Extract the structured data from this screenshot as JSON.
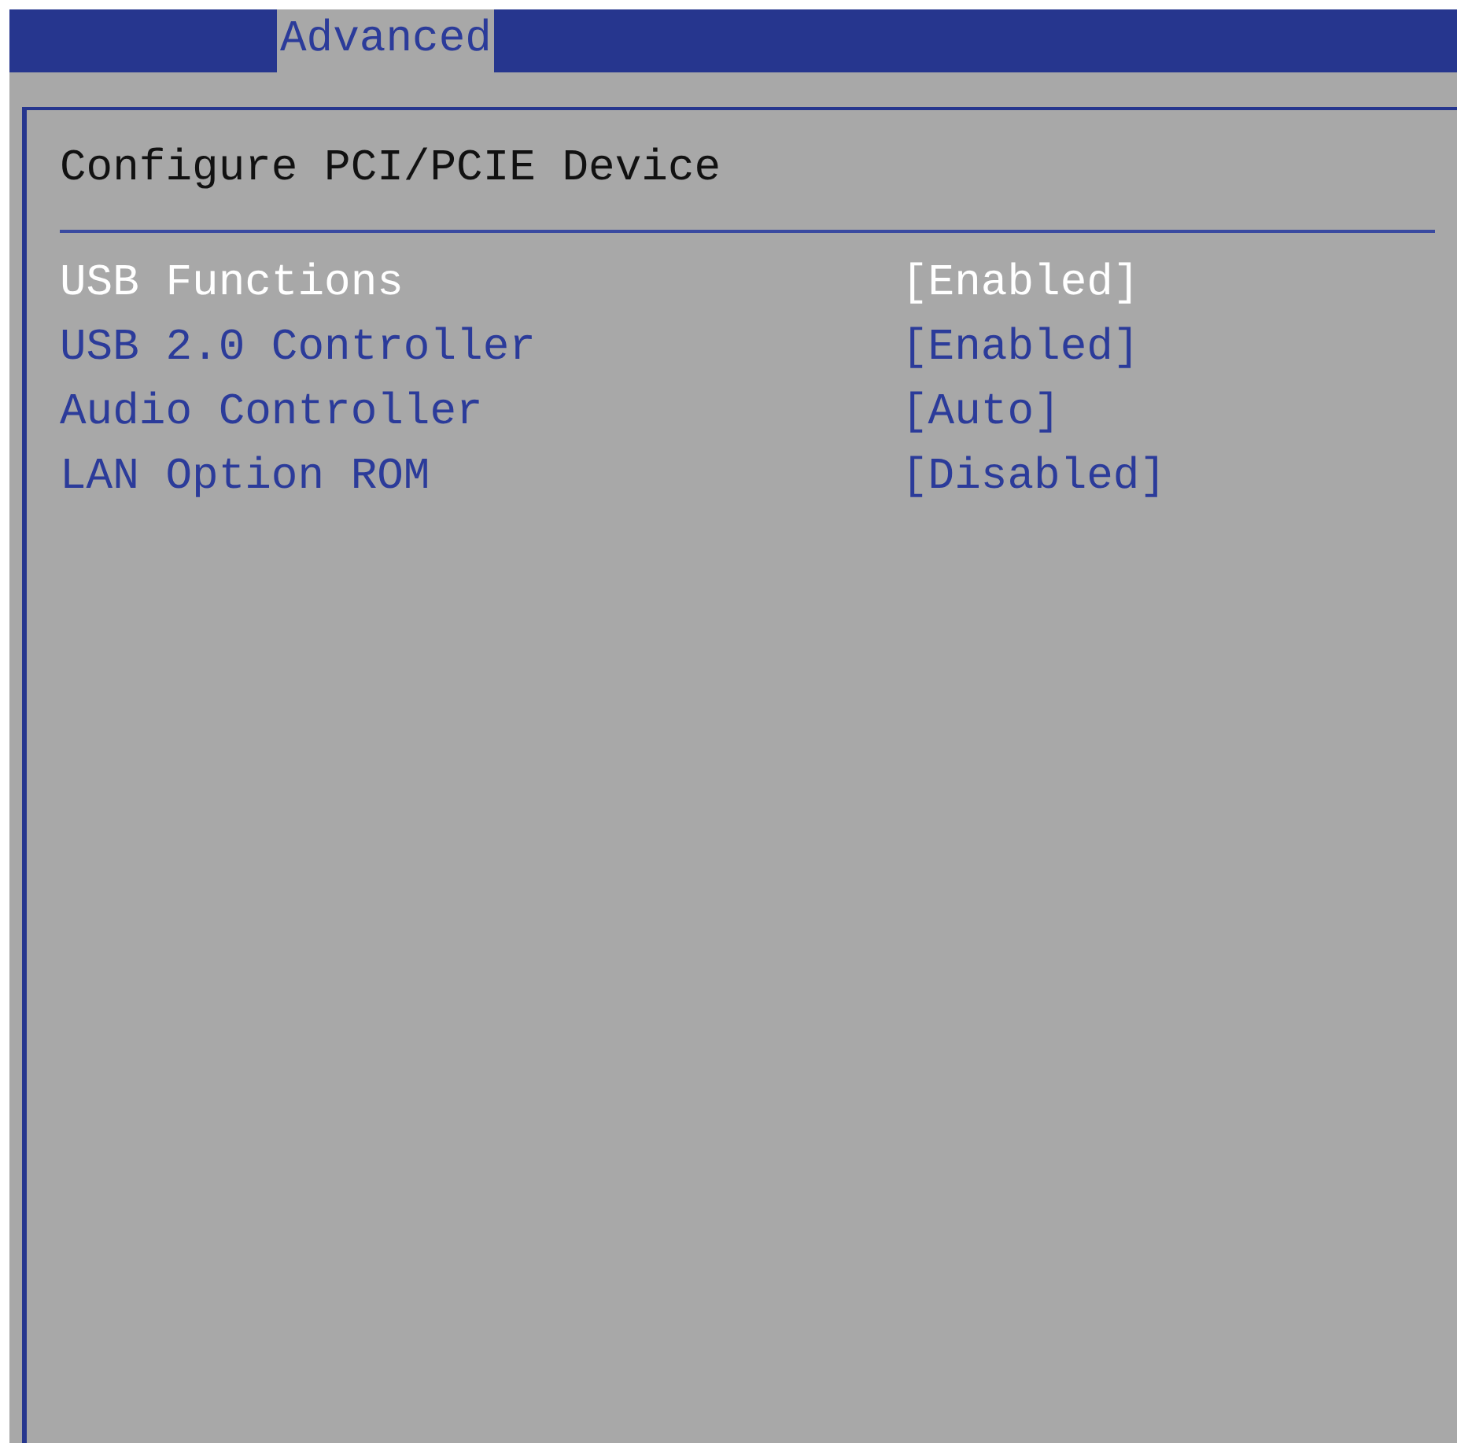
{
  "tabs": [
    {
      "label": "Advanced",
      "selected": true
    }
  ],
  "panel": {
    "title": "Configure PCI/PCIE Device",
    "settings": [
      {
        "label": "USB Functions",
        "value": "[Enabled]",
        "selected": true
      },
      {
        "label": "USB 2.0 Controller",
        "value": "[Enabled]",
        "selected": false
      },
      {
        "label": "Audio Controller",
        "value": "[Auto]",
        "selected": false
      },
      {
        "label": "LAN Option ROM",
        "value": "[Disabled]",
        "selected": false
      }
    ]
  }
}
